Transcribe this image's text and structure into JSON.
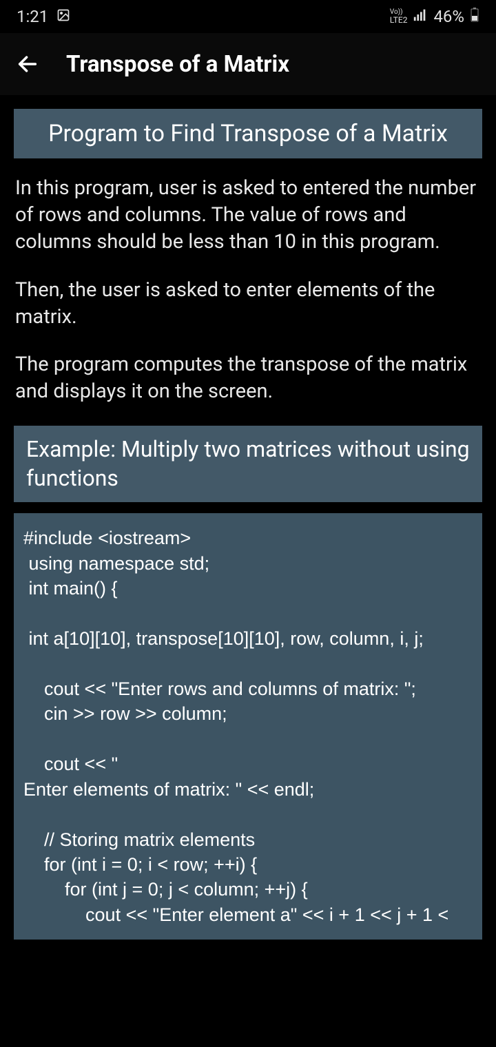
{
  "statusBar": {
    "time": "1:21",
    "lte": "LTE2",
    "vo": "Vo))",
    "battery": "46%"
  },
  "appBar": {
    "title": "Transpose of a Matrix"
  },
  "content": {
    "mainHeading": "Program to Find Transpose of a Matrix",
    "para1": "In this program, user is asked to entered the number of rows and columns. The value of rows and columns should be less than 10 in this program.",
    "para2": " Then, the user is asked to enter elements of the matrix.",
    "para3": " The program computes the transpose of the matrix and displays it on the screen.",
    "subHeading": "Example: Multiply two matrices without using functions",
    "code": "#include <iostream>\n using namespace std;\n int main() {\n\n int a[10][10], transpose[10][10], row, column, i, j;\n\n    cout << \"Enter rows and columns of matrix: \";\n    cin >> row >> column;\n\n    cout << \"\nEnter elements of matrix: \" << endl;\n\n    // Storing matrix elements\n    for (int i = 0; i < row; ++i) {\n        for (int j = 0; j < column; ++j) {\n            cout << \"Enter element a\" << i + 1 << j + 1 <"
  }
}
